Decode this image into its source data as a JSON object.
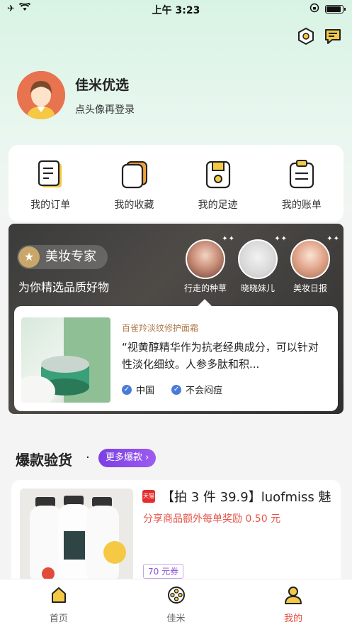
{
  "status_bar": {
    "time": "上午 3:23"
  },
  "profile": {
    "name": "佳米优选",
    "login_hint": "点头像再登录"
  },
  "quick_actions": [
    {
      "label": "我的订单",
      "icon": "orders-icon"
    },
    {
      "label": "我的收藏",
      "icon": "favorites-icon"
    },
    {
      "label": "我的足迹",
      "icon": "footprint-icon"
    },
    {
      "label": "我的账单",
      "icon": "bill-icon"
    }
  ],
  "beauty_section": {
    "title": "美妆专家",
    "subtitle": "为你精选品质好物",
    "influencers": [
      {
        "name": "行走的种草"
      },
      {
        "name": "晓晓妹儿"
      },
      {
        "name": "美妆日报"
      }
    ],
    "article": {
      "tag": "百雀羚淡纹修护面霜",
      "text": "“视黄醇精华作为抗老经典成分，可以针对性淡化细纹。人参多肽和积...",
      "checks": [
        "中国",
        "不会闷痘"
      ]
    }
  },
  "hot_section": {
    "title": "爆款验货",
    "dot": "·",
    "more_label": "更多爆款 ›"
  },
  "product": {
    "badge": "天猫",
    "title": "【拍 3 件 39.9】luofmiss 魅",
    "reward": "分享商品额外每单奖励 0.50 元",
    "coupon": "70 元券"
  },
  "tabbar": [
    {
      "label": "首页",
      "icon": "home-icon",
      "active": false
    },
    {
      "label": "佳米",
      "icon": "film-reel-icon",
      "active": false
    },
    {
      "label": "我的",
      "icon": "user-icon",
      "active": true
    }
  ],
  "colors": {
    "accent": "#e24a3b",
    "purple": "#7b3fe4",
    "icon_yellow": "#f6c945",
    "hero_green": "#d8f3e4"
  }
}
